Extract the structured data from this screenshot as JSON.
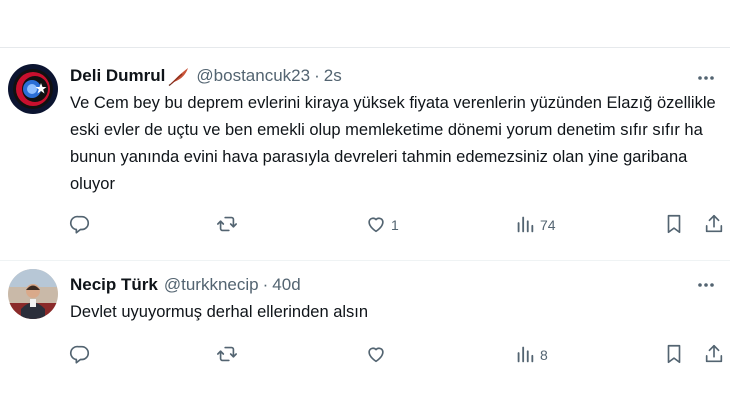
{
  "tweets": [
    {
      "name": "Deli Dumrul",
      "handle": "@bostancuk23",
      "separator": "·",
      "time": "2s",
      "text": "Ve Cem bey bu deprem evlerini kiraya yüksek fiyata verenlerin yüzünden Elazığ özellikle eski evler de uçtu ve ben emekli olup memleketime dönemi yorum denetim sıfır sıfır ha bunun yanında evini hava parasıyla devreleri tahmin edemezsiniz olan yine garibana oluyor",
      "likes": "1",
      "views": "74"
    },
    {
      "name": "Necip Türk",
      "handle": "@turkknecip",
      "separator": "·",
      "time": "40d",
      "text": "Devlet uyuyormuş derhal ellerinden alsın",
      "likes": "",
      "views": "8"
    }
  ],
  "icons": {
    "reply": "reply-icon",
    "retweet": "retweet-icon",
    "like": "heart-icon",
    "views": "views-icon",
    "bookmark": "bookmark-icon",
    "share": "share-icon",
    "more": "more-icon",
    "name_badge": "feather-icon"
  },
  "colors": {
    "text": "#0f1419",
    "secondary": "#536471",
    "divider": "#eff3f4"
  }
}
